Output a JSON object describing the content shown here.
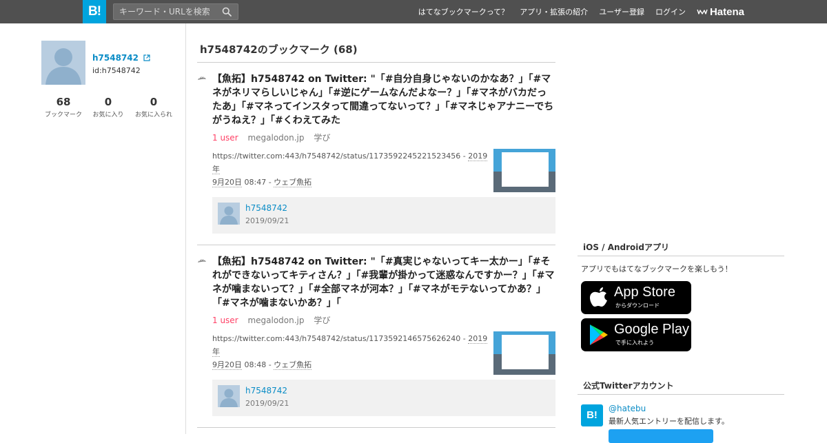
{
  "header": {
    "logo_text": "B!",
    "search_placeholder": "キーワード・URLを検索",
    "nav": [
      "はてなブックマークって？",
      "アプリ・拡張の紹介",
      "ユーザー登録",
      "ログイン"
    ],
    "hatena_label": "Hatena"
  },
  "profile": {
    "username": "h7548742",
    "id_text": "id:h7548742",
    "stats": [
      {
        "count": "68",
        "label": "ブックマーク"
      },
      {
        "count": "0",
        "label": "お気に入り"
      },
      {
        "count": "0",
        "label": "お気に入られ"
      }
    ]
  },
  "main": {
    "page_title": "h7548742のブックマーク (68)",
    "entries": [
      {
        "title": "【魚拓】h7548742 on Twitter: \"「#自分自身じゃないのかなあ？」「#マネがネリマらしいじゃん」「#逆にゲームなんだよなー？」「#マネがバカだったあ」「#マネってインスタって間違ってないって？」「#マネじゃアナニーでちがうねえ？」「#くわえてみた",
        "users": "1 user",
        "domain": "megalodon.jp",
        "tag": "学び",
        "url": "https://twitter.com:443/h7548742/status/1173592245221523456",
        "sep": " - ",
        "date_a": "2019年",
        "date_b": "9月20日",
        "time": " 08:47 - ",
        "category": "ウェブ魚拓",
        "comment_user": "h7548742",
        "comment_date": "2019/09/21"
      },
      {
        "title": "【魚拓】h7548742 on Twitter: \"「#真実じゃないってキー太かー」「#それができないってキティさん？」「#我輩が掛かって迷惑なんですかー？」「#マネが噛まないって？」「#全部マネが河本？」「#マネがモテないってかあ？」「#マネが噛まないかあ？」「",
        "users": "1 user",
        "domain": "megalodon.jp",
        "tag": "学び",
        "url": "https://twitter.com:443/h7548742/status/1173592146575626240",
        "sep": " - ",
        "date_a": "2019年",
        "date_b": "9月20日",
        "time": " 08:48 - ",
        "category": "ウェブ魚拓",
        "comment_user": "h7548742",
        "comment_date": "2019/09/21"
      }
    ]
  },
  "sidebar": {
    "apps_heading": "iOS / Androidアプリ",
    "apps_text": "アプリでもはてなブックマークを楽しもう！",
    "app_store": {
      "main": "App Store",
      "sub": "からダウンロード"
    },
    "google_play": {
      "main": "Google Play",
      "sub": "で手に入れよう"
    },
    "twitter_heading": "公式Twitterアカウント",
    "twitter_logo": "B!",
    "twitter_handle": "@hatebu",
    "twitter_desc": "最新人気エントリーを配信します。"
  },
  "colors": {
    "header_bg": "#505050",
    "brand_blue": "#00a4de",
    "link_blue": "#0a8cc6",
    "users_red": "#ff4166"
  }
}
